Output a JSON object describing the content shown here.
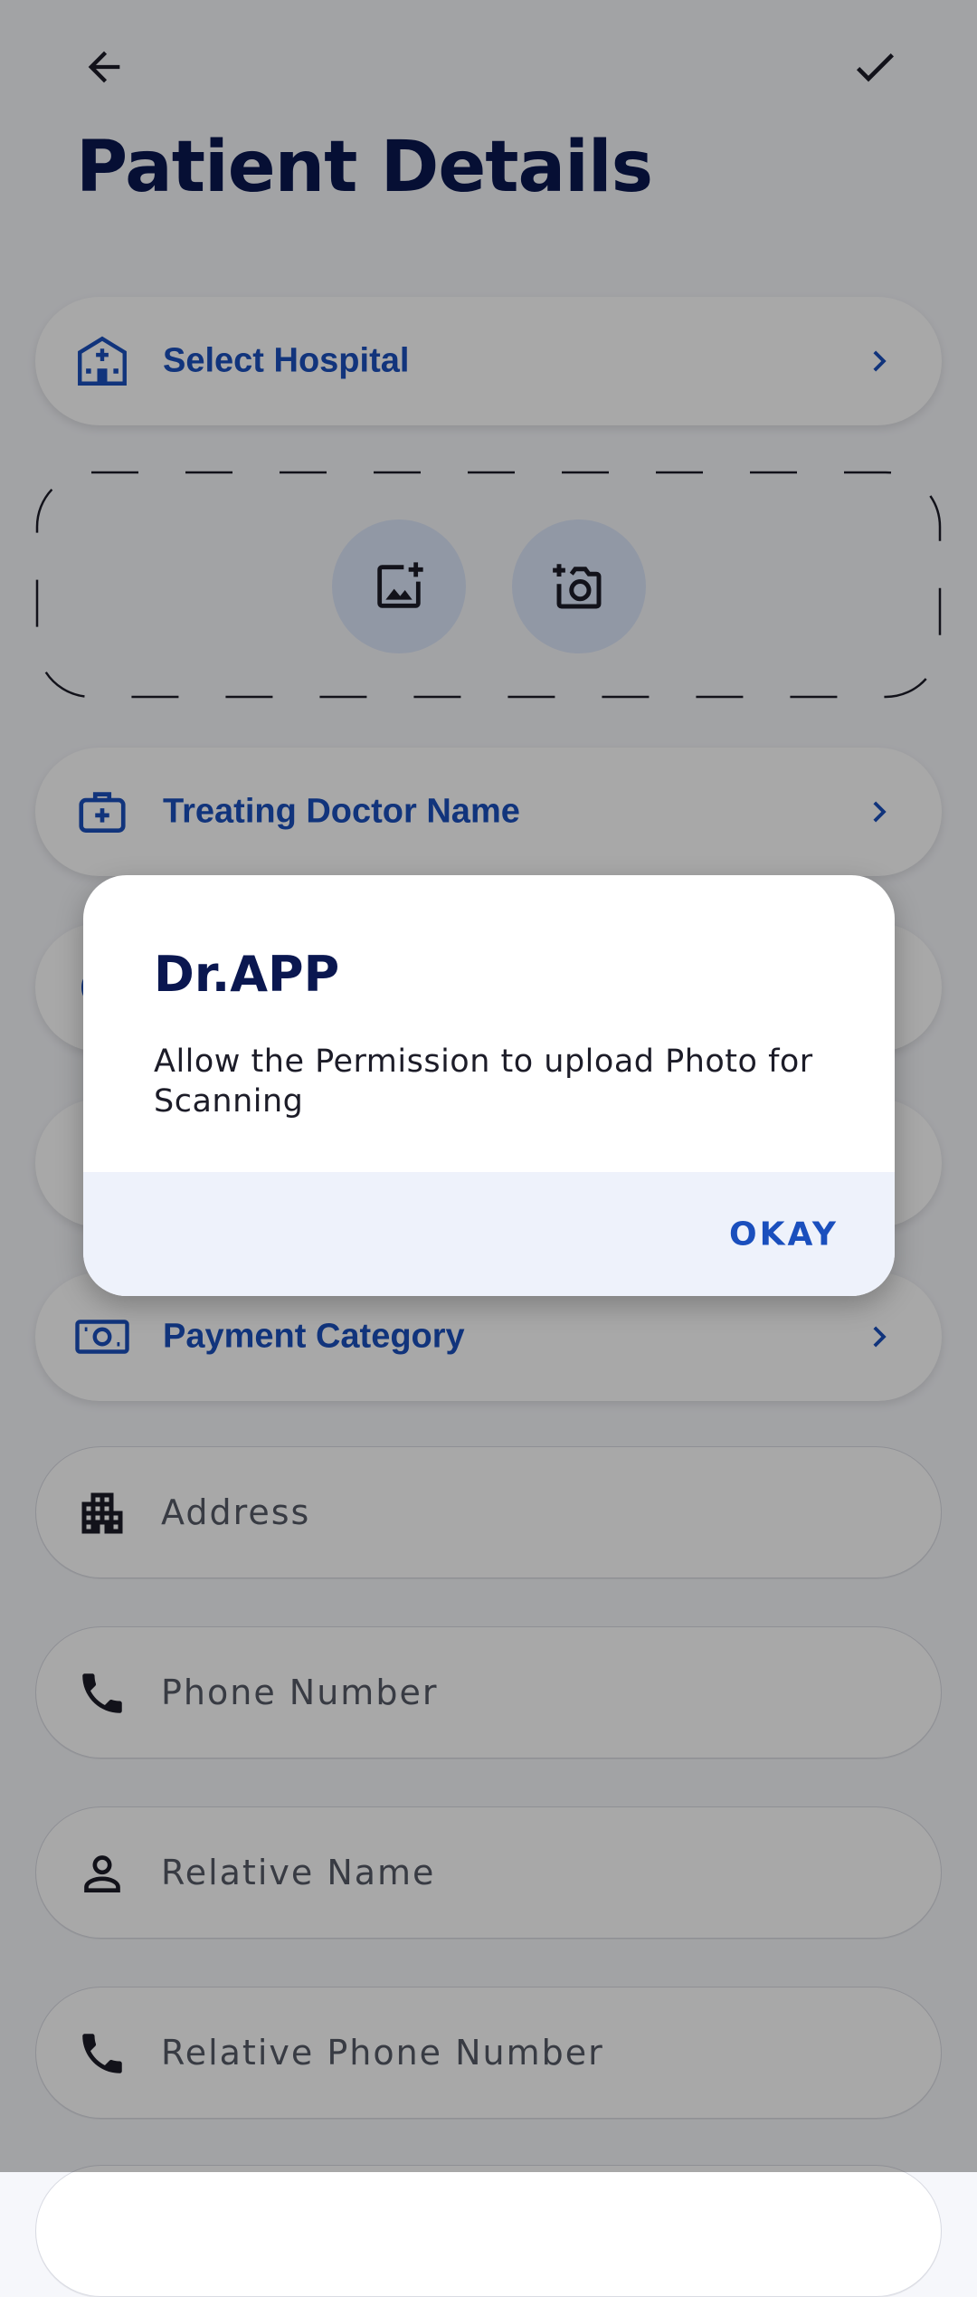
{
  "header": {
    "title": "Patient Details",
    "back_icon": "arrow-left-icon",
    "confirm_icon": "check-icon"
  },
  "form": {
    "select_rows": [
      {
        "label": "Select Hospital",
        "icon": "hospital-icon"
      },
      {
        "label": "Treating Doctor Name",
        "icon": "medical-bag-icon"
      },
      {
        "label": "Payment Category",
        "icon": "cash-icon"
      }
    ],
    "upload": {
      "gallery_icon": "add-photo-icon",
      "camera_icon": "add-camera-icon"
    },
    "fields": [
      {
        "placeholder": "Address",
        "icon": "building-icon"
      },
      {
        "placeholder": "Phone Number",
        "icon": "phone-icon"
      },
      {
        "placeholder": "Relative Name",
        "icon": "person-icon"
      },
      {
        "placeholder": "Relative Phone Number",
        "icon": "phone-icon"
      }
    ]
  },
  "dialog": {
    "title": "Dr.APP",
    "message": "Allow the Permission to upload Photo for Scanning",
    "ok_label": "OKAY"
  },
  "colors": {
    "accent": "#1a4fbd",
    "title": "#0a1750",
    "background": "#f6f7fb",
    "upload_button": "#dde7fb"
  }
}
